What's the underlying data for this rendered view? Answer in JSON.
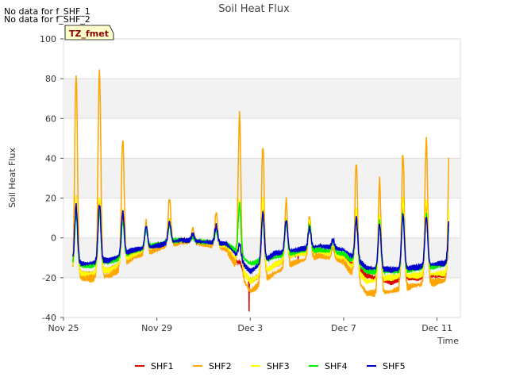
{
  "notes": [
    "No data for f_SHF_1",
    "No data for f_SHF_2"
  ],
  "chart_data": {
    "type": "line",
    "title": "Soil Heat Flux",
    "xlabel": "Time",
    "ylabel": "Soil Heat Flux",
    "ylim": [
      -40,
      100
    ],
    "xlim_days": [
      0,
      17
    ],
    "xticks": [
      {
        "label": "Nov 25",
        "day": 0
      },
      {
        "label": "Nov 29",
        "day": 4
      },
      {
        "label": "Dec 3",
        "day": 8
      },
      {
        "label": "Dec 7",
        "day": 12
      },
      {
        "label": "Dec 11",
        "day": 16
      }
    ],
    "yticks": [
      -40,
      -20,
      0,
      20,
      40,
      60,
      80,
      100
    ],
    "tz_label": "TZ_fmet",
    "series": [
      {
        "name": "SHF1",
        "color": "#dd0000",
        "night": [
          -17,
          -18,
          -16,
          -8,
          -4,
          -1,
          -2,
          -4,
          -22,
          -14,
          -8,
          -7,
          -10,
          -19,
          -22,
          -20,
          -19,
          -17
        ],
        "peaks": [
          20,
          19,
          12,
          6,
          9,
          1,
          5,
          -12,
          14,
          10,
          8,
          -1,
          10,
          10,
          18,
          18,
          14
        ],
        "extra": [
          {
            "t": 7.95,
            "v": -37
          },
          {
            "t": 10.05,
            "v": -13
          }
        ]
      },
      {
        "name": "SHF2",
        "color": "#ffa500",
        "night": [
          -20,
          -20,
          -19,
          -10,
          -6,
          -2,
          -3,
          -6,
          -27,
          -18,
          -12,
          -9,
          -12,
          -28,
          -27,
          -24,
          -22,
          -20
        ],
        "peaks": [
          82,
          84,
          50,
          8,
          20,
          5,
          13,
          62,
          47,
          19,
          11,
          -5,
          38,
          29,
          43,
          50,
          56
        ],
        "extra": []
      },
      {
        "name": "SHF3",
        "color": "#ffff00",
        "night": [
          -17,
          -18,
          -16,
          -8,
          -4,
          -1,
          -2,
          -4,
          -22,
          -14,
          -8,
          -7,
          -10,
          -22,
          -20,
          -19,
          -18,
          -17
        ],
        "peaks": [
          20,
          21,
          14,
          6,
          9,
          1,
          5,
          20,
          20,
          10,
          8,
          -1,
          14,
          12,
          20,
          20,
          23
        ],
        "extra": []
      },
      {
        "name": "SHF4",
        "color": "#00ee00",
        "night": [
          -13,
          -14,
          -12,
          -7,
          -3,
          -1,
          -2,
          -3,
          -13,
          -10,
          -7,
          -6,
          -8,
          -17,
          -17,
          -16,
          -14,
          -13
        ],
        "peaks": [
          12,
          14,
          8,
          4,
          6,
          0,
          3,
          17,
          10,
          8,
          7,
          -2,
          10,
          8,
          13,
          12,
          10
        ],
        "extra": []
      },
      {
        "name": "SHF5",
        "color": "#0000cc",
        "night": [
          -12,
          -13,
          -11,
          -6,
          -4,
          -1,
          -2,
          -3,
          -17,
          -8,
          -6,
          -4,
          -6,
          -15,
          -16,
          -15,
          -13,
          -12
        ],
        "peaks": [
          16,
          17,
          13,
          6,
          8,
          2,
          6,
          -3,
          13,
          9,
          5,
          -1,
          10,
          7,
          12,
          11,
          14
        ],
        "extra": []
      }
    ]
  }
}
